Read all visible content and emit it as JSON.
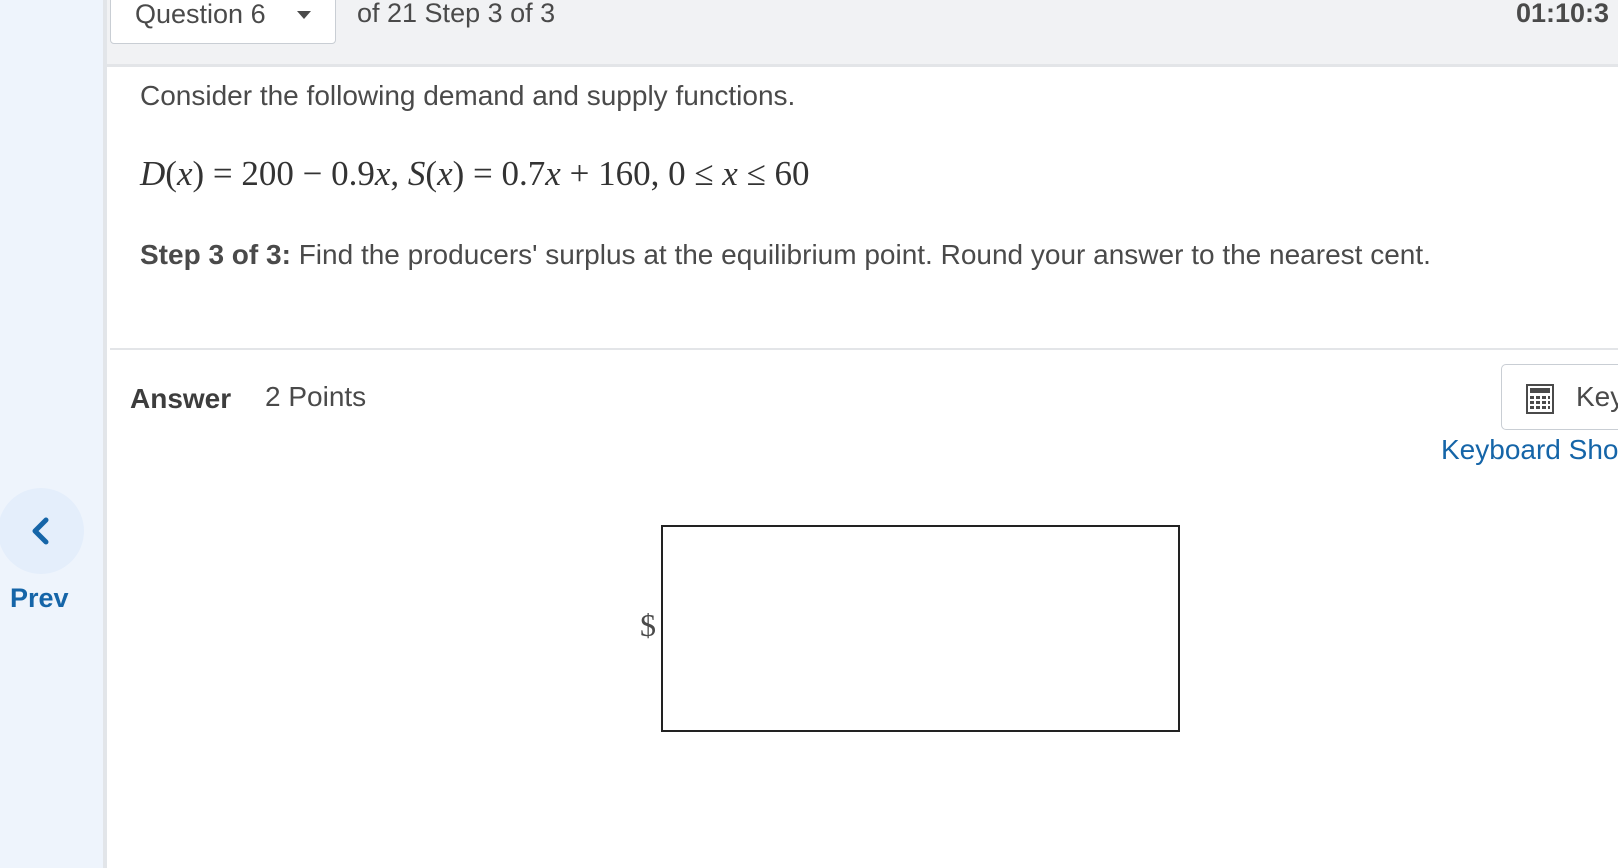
{
  "header": {
    "question_selector": "Question 6",
    "step_info": "of 21 Step 3 of 3",
    "timer": "01:10:3"
  },
  "nav": {
    "prev_label": "Prev"
  },
  "question": {
    "intro": "Consider the following demand and supply functions.",
    "equation": {
      "D_name": "D",
      "x_var": "x",
      "eq1_rhs_const": " = 200 − 0.9",
      "S_name": "S",
      "eq2_rhs_coef": " = 0.7",
      "eq2_rhs_const": " + 160, 0 ≤ ",
      "upper_bound": " ≤ 60"
    },
    "step_label": "Step 3 of 3:",
    "step_text": " Find the producers' surplus at the equilibrium point. Round your answer to the nearest cent."
  },
  "answer": {
    "heading": "Answer",
    "points": "2 Points",
    "keypad_label": "Key",
    "shortcuts_link": "Keyboard Sho",
    "currency_symbol": "$",
    "input_value": ""
  }
}
